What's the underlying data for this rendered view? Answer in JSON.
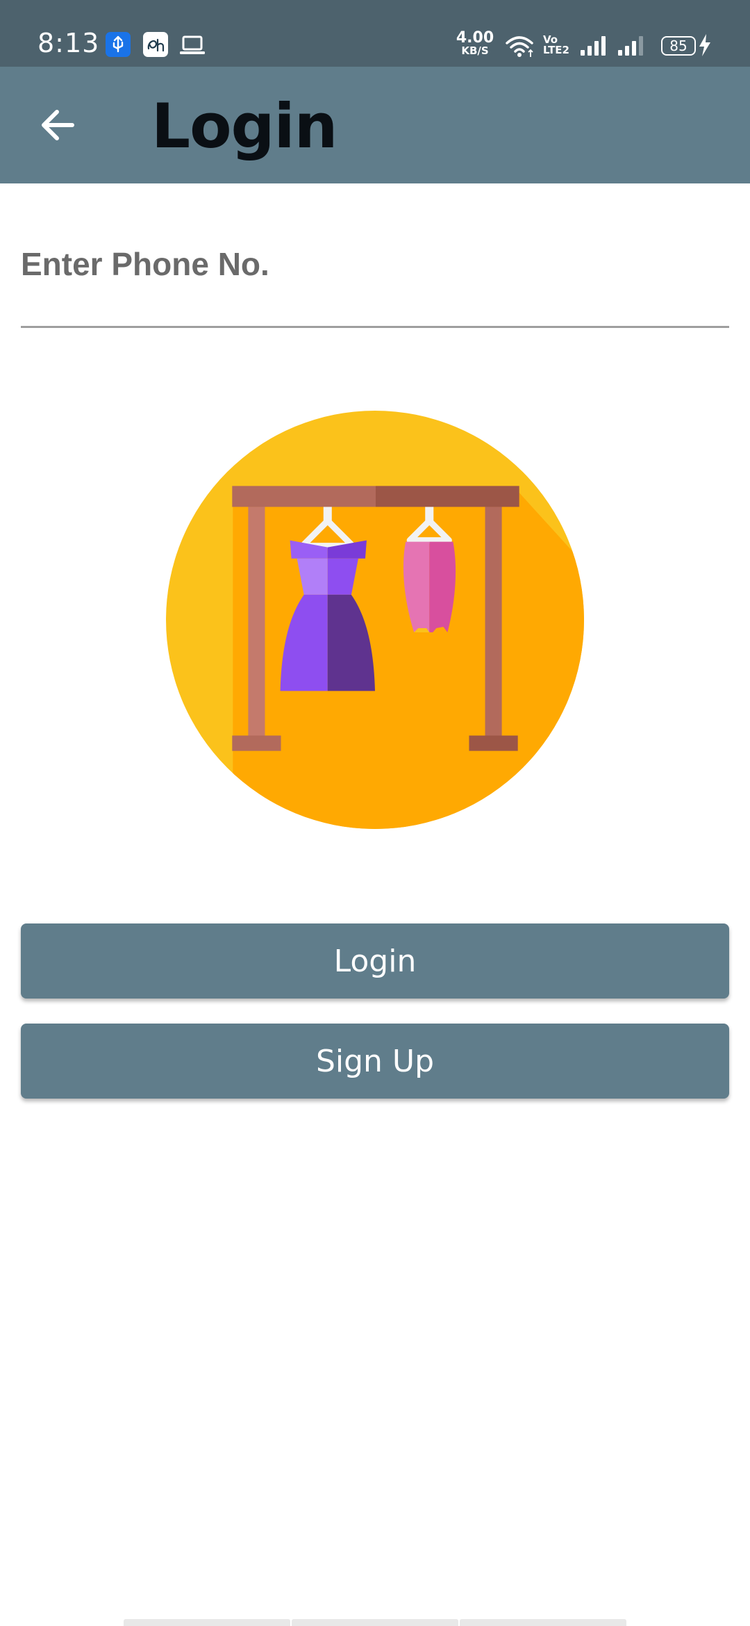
{
  "status_bar": {
    "time": "8:13",
    "net_speed_value": "4.00",
    "net_speed_unit": "KB/S",
    "volte_label": "Vo LTE2",
    "battery": "85",
    "icons": [
      "usb-debug-icon",
      "hotstar-icon",
      "laptop-icon",
      "wifi-icon",
      "signal-icon",
      "signal-icon",
      "battery-icon",
      "charging-icon"
    ]
  },
  "app_bar": {
    "title": "Login",
    "back_icon": "arrow-left-icon"
  },
  "form": {
    "phone_placeholder": "Enter Phone No.",
    "phone_value": ""
  },
  "hero": {
    "icon": "clothes-rack-icon",
    "colors": {
      "circle": "#fbc21b",
      "shadow": "#ffa902",
      "rack": "#b26a5c",
      "dress": "#8e4ef0",
      "skirt": "#e574b3"
    }
  },
  "buttons": {
    "login_label": "Login",
    "signup_label": "Sign Up"
  },
  "theme": {
    "status_bar_bg": "#4d626d",
    "app_bar_bg": "#607d8b",
    "button_bg": "#607d8b",
    "button_text": "#ffffff"
  }
}
